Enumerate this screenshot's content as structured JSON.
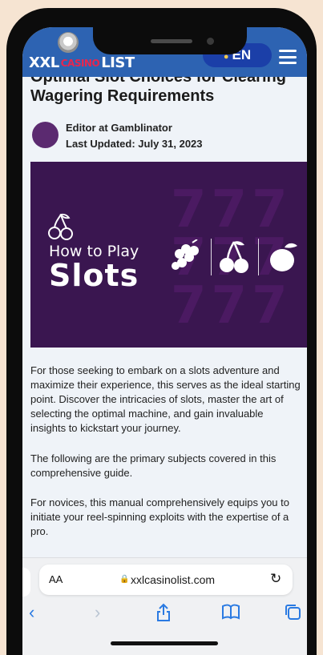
{
  "site": {
    "logo_left": "XXL",
    "logo_mid": "CASINO",
    "logo_right": "LIST",
    "language": "EN"
  },
  "article": {
    "title": "Optimal Slot Choices for Clearing Wagering Requirements",
    "author": "Editor at Gamblinator",
    "updated": "Last Updated: July 31, 2023",
    "banner": {
      "small": "How to Play",
      "big": "Slots",
      "background": "#3a1650"
    },
    "paragraphs": [
      "For those seeking to embark on a slots adventure and maximize their experience, this serves as the ideal starting point. Discover the intricacies of slots, master the art of selecting the optimal machine, and gain invaluable insights to kickstart your journey.",
      "The following are the primary subjects covered in this comprehensive guide.",
      "For novices, this manual comprehensively equips you to initiate your reel-spinning exploits with the expertise of a pro."
    ]
  },
  "browser": {
    "text_size": "AA",
    "url": "xxlcasinolist.com",
    "toolbar_icons": [
      "back-icon",
      "forward-icon",
      "share-icon",
      "bookmarks-icon",
      "tabs-icon"
    ]
  },
  "colors": {
    "header": "#2d63b2",
    "accent": "#2a7ae2"
  }
}
